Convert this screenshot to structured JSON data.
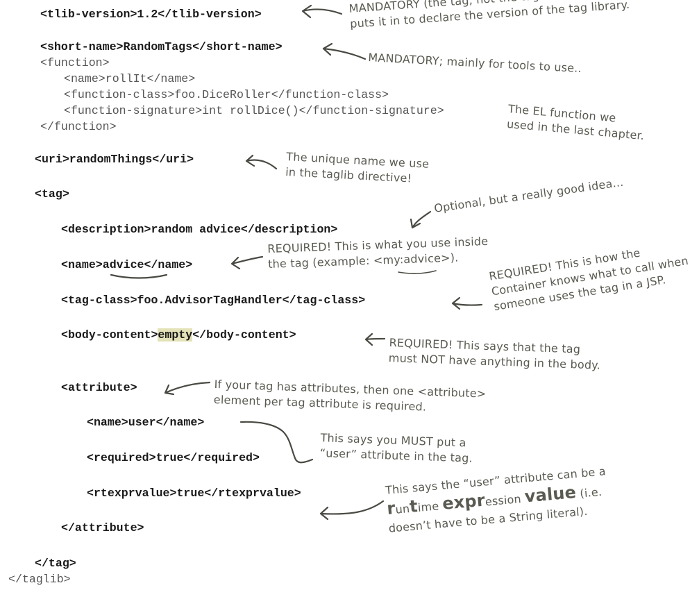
{
  "code_lines": {
    "tlib_version": "<tlib-version>1.2</tlib-version>",
    "short_name": "<short-name>RandomTags</short-name>",
    "function_open": "<function>",
    "function_name": "<name>rollIt</name>",
    "function_class": "<function-class>foo.DiceRoller</function-class>",
    "function_signature": "<function-signature>int rollDice()</function-signature>",
    "function_close": "</function>",
    "uri": "<uri>randomThings</uri>",
    "tag_open": "<tag>",
    "description": "<description>random advice</description>",
    "name_prefix": "<name>",
    "name_value": "advice",
    "name_suffix": "</name>",
    "tag_class": "<tag-class>foo.AdvisorTagHandler</tag-class>",
    "body_content_prefix": "<body-content>",
    "body_content_value": "empty",
    "body_content_suffix": "</body-content>",
    "attribute_open": "<attribute>",
    "attr_name": "<name>user</name>",
    "attr_required": "<required>true</required>",
    "attr_rtexprvalue": "<rtexprvalue>true</rtexprvalue>",
    "attribute_close": "</attribute>",
    "tag_close": "</tag>",
    "taglib_close": "</taglib>"
  },
  "annotations": {
    "tlib_version": "MANDATORY (the tag, not the tag library\nputs it in to declare the version of the tag library.",
    "short_name": "MANDATORY; mainly for tools to use..",
    "function": "The EL function we\nused in the last chapter.",
    "uri": "The unique name we use\nin the taglib directive!",
    "description": "Optional, but a really good idea...",
    "name": "REQUIRED! This is what you use inside\nthe tag (example: <my:advice>).",
    "tag_class": "REQUIRED! This is how the\nContainer knows what to call when\nsomeone uses the tag in a JSP.",
    "body_content": "REQUIRED! This says that the tag\nmust NOT have anything in the body.",
    "attribute": "If your tag has attributes, then one <attribute>\nelement per tag attribute is required.",
    "required": "This says you MUST put a\n“user” attribute in the tag.",
    "rtexpr_line1_a": "This says the “user” attribute can be a",
    "rtexpr_r": "r",
    "rtexpr_un": "un",
    "rtexpr_t": "t",
    "rtexpr_ime": "ime ",
    "rtexpr_expr": "expr",
    "rtexpr_ession": "ession ",
    "rtexpr_value": "value",
    "rtexpr_ie": " (i.e.",
    "rtexpr_line3": "doesn’t have to be a String literal)."
  }
}
